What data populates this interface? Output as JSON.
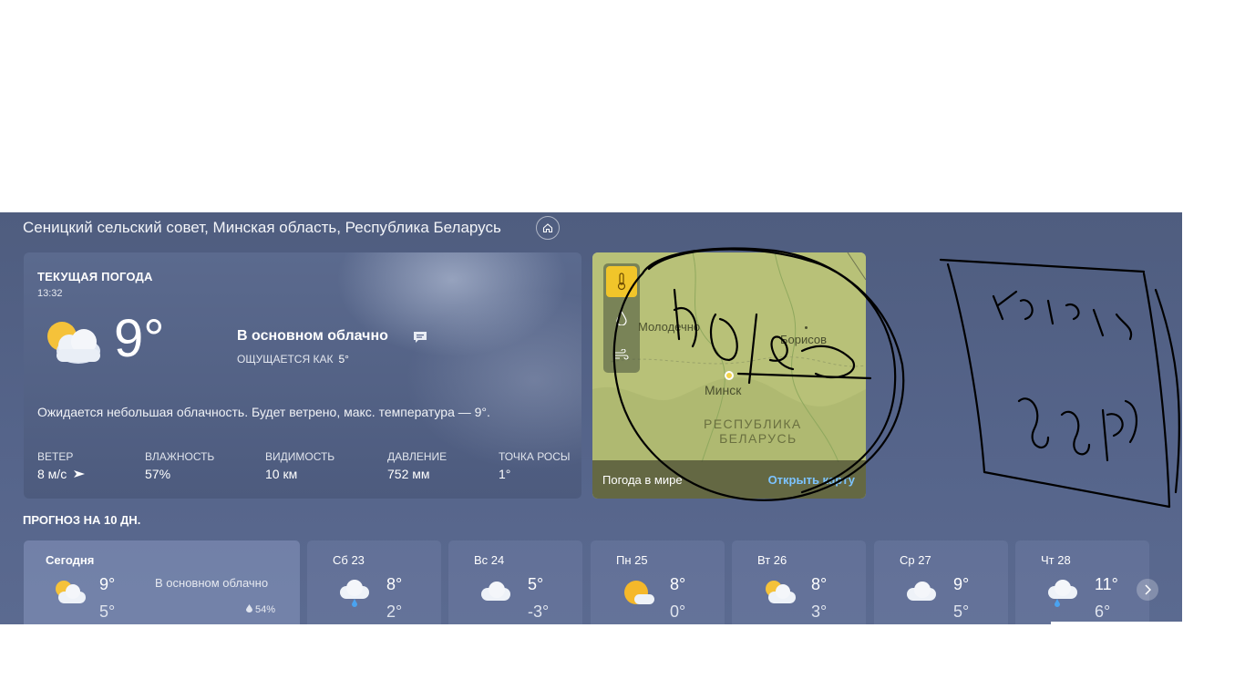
{
  "header": {
    "location": "Сеницкий сельский совет, Минская область, Республика Беларусь"
  },
  "current": {
    "title": "ТЕКУЩАЯ ПОГОДА",
    "time": "13:32",
    "temp": "9°",
    "condition": "В основном облачно",
    "feels_label": "ОЩУЩАЕТСЯ КАК",
    "feels_value": "5°",
    "description": "Ожидается небольшая облачность. Будет ветрено, макс. температура — 9°.",
    "metrics": [
      {
        "label": "ВЕТЕР",
        "value": "8 м/с"
      },
      {
        "label": "ВЛАЖНОСТЬ",
        "value": "57%"
      },
      {
        "label": "ВИДИМОСТЬ",
        "value": "10 км"
      },
      {
        "label": "ДАВЛЕНИЕ",
        "value": "752 мм"
      },
      {
        "label": "ТОЧКА РОСЫ",
        "value": "1°"
      }
    ]
  },
  "map": {
    "cities": [
      "Молодечно",
      "Борисов",
      "Минск"
    ],
    "country_line1": "РЕСПУБЛИКА",
    "country_line2": "БЕЛАРУСЬ",
    "world_label": "Погода в мире",
    "open_label": "Открыть карту"
  },
  "forecast": {
    "title": "ПРОГНОЗ НА 10 ДН.",
    "days": [
      {
        "name": "Сегодня",
        "hi": "9°",
        "lo": "5°",
        "condition": "В основном облачно",
        "precip": "54%",
        "icon": "partly-cloudy-icon"
      },
      {
        "name": "Сб 23",
        "hi": "8°",
        "lo": "2°",
        "icon": "rain-cloud-icon"
      },
      {
        "name": "Вс 24",
        "hi": "5°",
        "lo": "-3°",
        "icon": "cloud-icon"
      },
      {
        "name": "Пн 25",
        "hi": "8°",
        "lo": "0°",
        "icon": "mostly-sunny-icon"
      },
      {
        "name": "Вт 26",
        "hi": "8°",
        "lo": "3°",
        "icon": "partly-cloudy-icon"
      },
      {
        "name": "Ср 27",
        "hi": "9°",
        "lo": "5°",
        "icon": "cloud-icon"
      },
      {
        "name": "Чт 28",
        "hi": "11°",
        "lo": "6°",
        "icon": "rain-cloud-icon"
      }
    ]
  },
  "annotations": {
    "handwritten": [
      "Чолс",
      "Калеч.",
      "99Рб"
    ]
  }
}
